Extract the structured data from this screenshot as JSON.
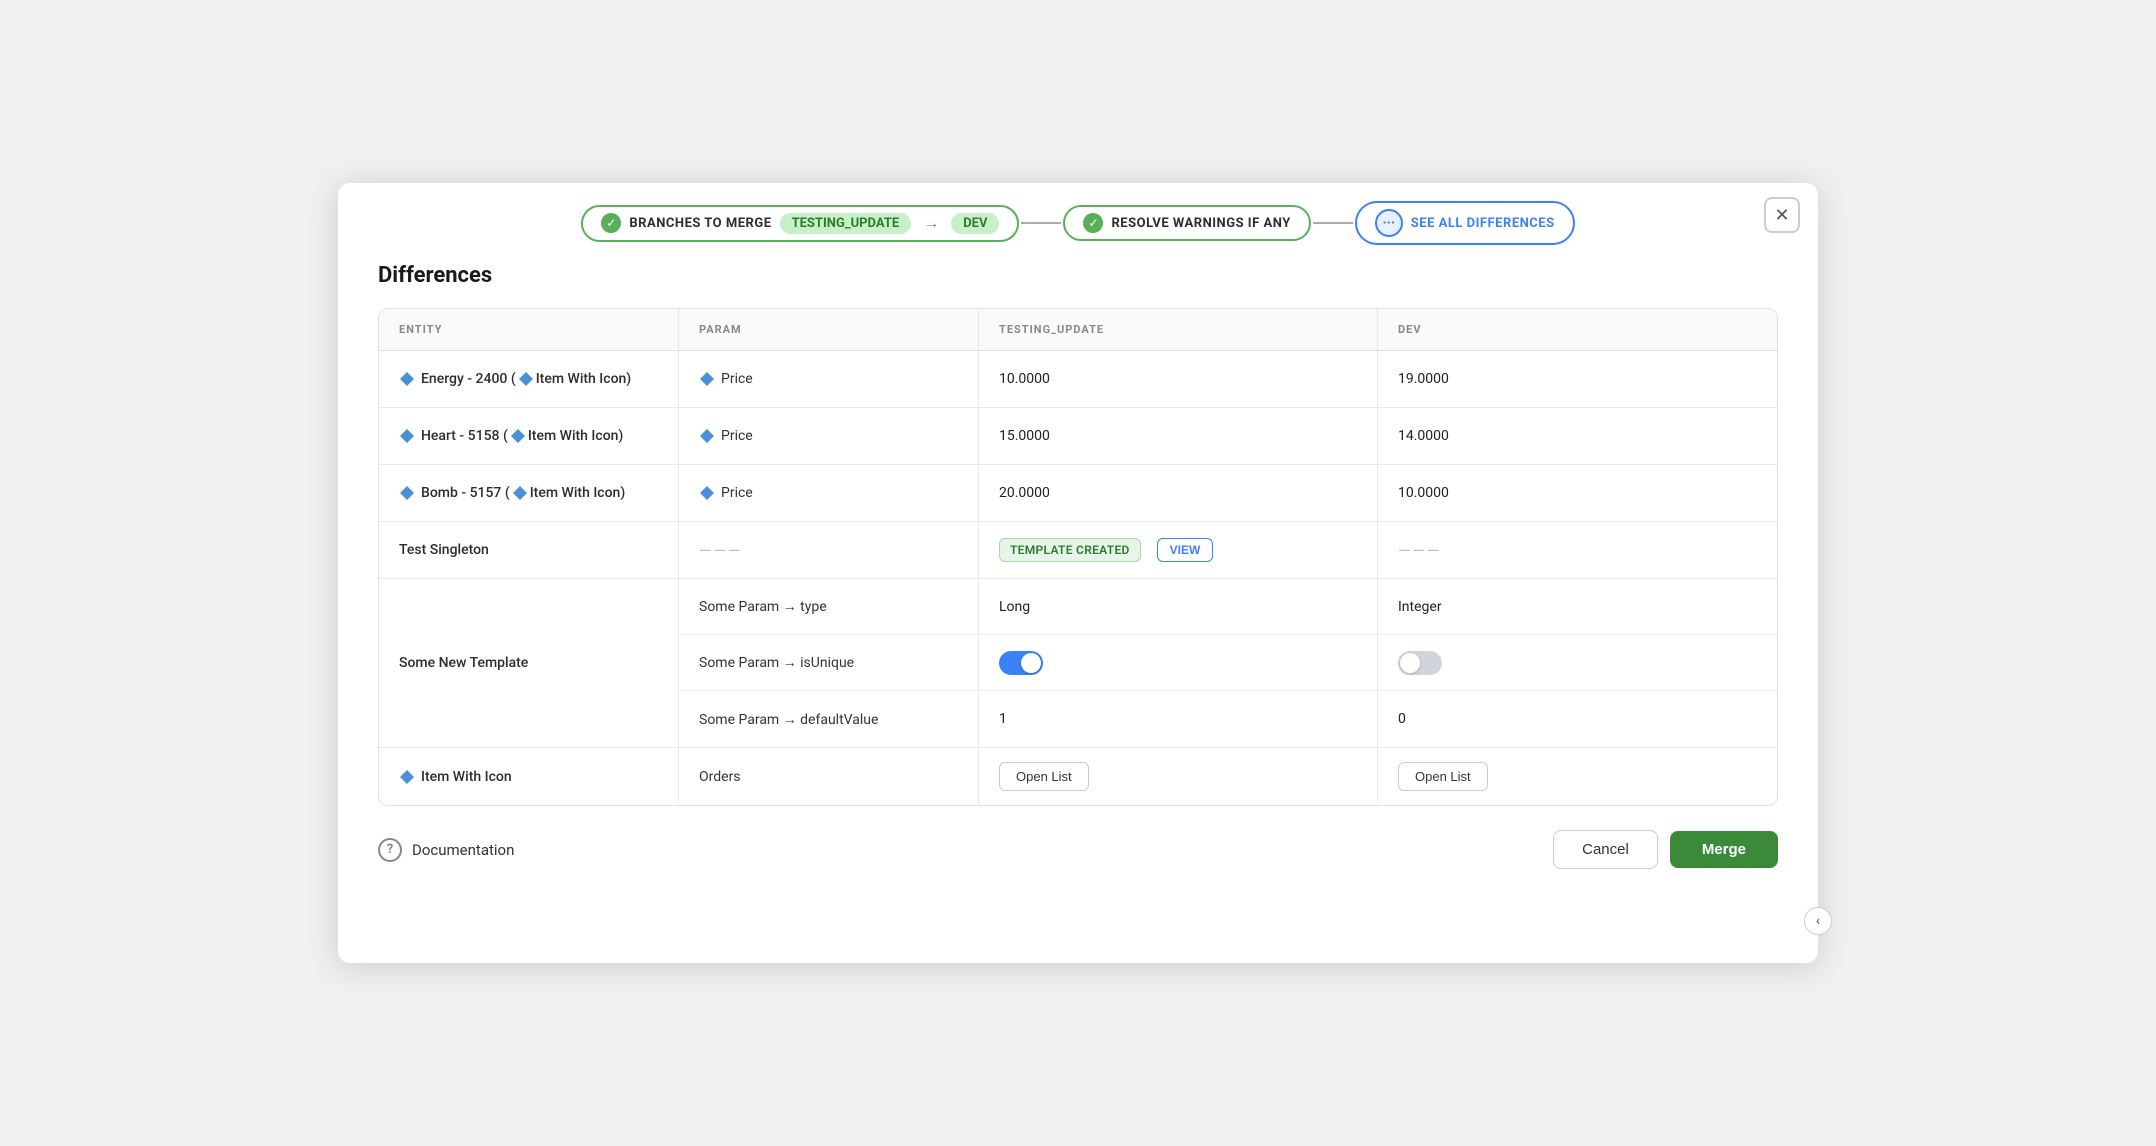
{
  "workflow": {
    "step1": {
      "label": "BRANCHES TO MERGE",
      "from": "TESTING_UPDATE",
      "arrow": "→",
      "to": "DEV"
    },
    "step2": {
      "label": "RESOLVE WARNINGS IF ANY"
    },
    "step3": {
      "label": "SEE ALL DIFFERENCES"
    }
  },
  "close_label": "✕",
  "section_title": "Differences",
  "table": {
    "headers": [
      "ENTITY",
      "PARAM",
      "TESTING_UPDATE",
      "DEV"
    ],
    "rows": [
      {
        "type": "simple",
        "entity": "Energy - 2400 (💎 Item With Icon)",
        "entity_has_diamond": true,
        "param": "Price",
        "param_has_diamond": true,
        "testing_update": "10.0000",
        "dev": "19.0000"
      },
      {
        "type": "simple",
        "entity": "Heart - 5158 (💎 Item With Icon)",
        "entity_has_diamond": true,
        "param": "Price",
        "param_has_diamond": true,
        "testing_update": "15.0000",
        "dev": "14.0000"
      },
      {
        "type": "simple",
        "entity": "Bomb - 5157 (💎 Item With Icon)",
        "entity_has_diamond": true,
        "param": "Price",
        "param_has_diamond": true,
        "testing_update": "20.0000",
        "dev": "10.0000"
      },
      {
        "type": "singleton",
        "entity": "Test Singleton",
        "param": "———",
        "testing_update_badge": "TEMPLATE CREATED",
        "testing_update_view": "VIEW",
        "dev": "———"
      },
      {
        "type": "compound",
        "entity": "Some New Template",
        "sub_rows": [
          {
            "param": "Some Param → type",
            "testing_update": "Long",
            "dev": "Integer",
            "dev_type": "text"
          },
          {
            "param": "Some Param → isUnique",
            "testing_update_type": "toggle_on",
            "dev_type": "toggle_off"
          },
          {
            "param": "Some Param → defaultValue",
            "testing_update": "1",
            "dev": "0"
          }
        ]
      },
      {
        "type": "item_with_icon",
        "entity": "Item With Icon",
        "entity_has_diamond": true,
        "param": "Orders",
        "testing_update_btn": "Open List",
        "dev_btn": "Open List"
      }
    ]
  },
  "documentation_label": "Documentation",
  "cancel_label": "Cancel",
  "merge_label": "Merge"
}
